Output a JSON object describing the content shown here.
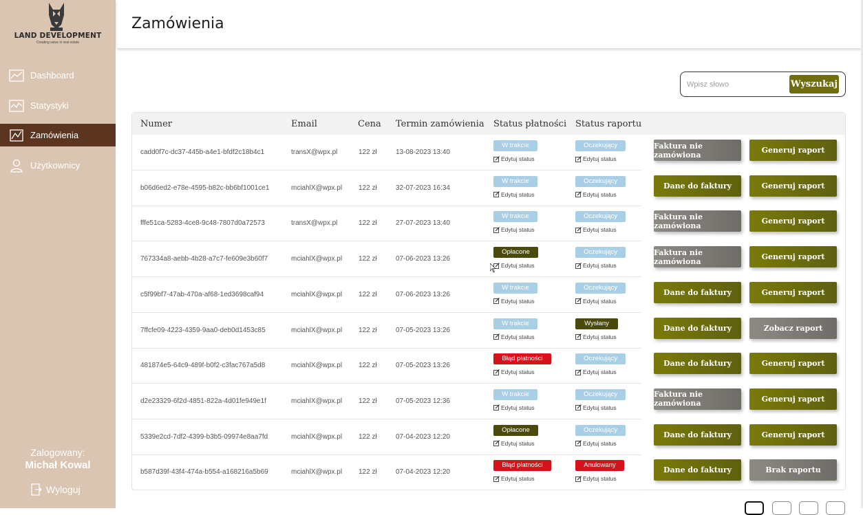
{
  "app": {
    "logo_title": "LAND DEVELOPMENT",
    "logo_subtitle": "Creating value in real estate"
  },
  "sidebar": {
    "items": [
      {
        "label": "Dashboard",
        "icon": "chart-line-icon"
      },
      {
        "label": "Statystyki",
        "icon": "trend-chart-icon"
      },
      {
        "label": "Zamówienia",
        "icon": "orders-chart-icon",
        "active": true
      },
      {
        "label": "Użytkownicy",
        "icon": "user-icon"
      }
    ],
    "logged_label": "Zalogowany:",
    "user_name": "Michał Kowal",
    "logout_label": "Wyloguj"
  },
  "header": {
    "title": "Zamówienia"
  },
  "search": {
    "placeholder": "Wpisz słowo",
    "button_label": "Wyszukaj"
  },
  "table": {
    "columns": [
      "Numer",
      "Email",
      "Cena",
      "Termin zamówienia",
      "Status płatności",
      "Status raportu"
    ],
    "edit_label": "Edytuj status",
    "rows": [
      {
        "numer": "cadd0f7c-dc37-445b-a4e1-bfdf2c18b4c1",
        "email": "transX@wpx.pl",
        "cena": "122 zł",
        "termin": "13-08-2023 13:40",
        "platnosc": "W trakcie",
        "raport": "Oczekujący",
        "btn1": "Faktura nie zamówiona",
        "btn2": "Generuj raport"
      },
      {
        "numer": "b06d6ed2-e78e-4595-b82c-bb6bf1001ce1",
        "email": "mciahlX@wpx.pl",
        "cena": "122 zł",
        "termin": "32-07-2023 16:34",
        "platnosc": "W trakcie",
        "raport": "Oczekujący",
        "btn1": "Dane do faktury",
        "btn2": "Generuj raport"
      },
      {
        "numer": "fffe51ca-5283-4ce8-9c48-7807d0a72573",
        "email": "transX@wpx.pl",
        "cena": "122 zł",
        "termin": "27-07-2023 13:40",
        "platnosc": "W trakcie",
        "raport": "Oczekujący",
        "btn1": "Faktura nie zamówiona",
        "btn2": "Generuj raport"
      },
      {
        "numer": "767334a8-aebb-4b28-a7c7-fe609e3b60f7",
        "email": "mciahlX@wpx.pl",
        "cena": "122 zł",
        "termin": "07-06-2023 13:26",
        "platnosc": "Opłacone",
        "raport": "Oczekujący",
        "btn1": "Faktura nie zamówiona",
        "btn2": "Generuj raport"
      },
      {
        "numer": "c5f99bf7-47ab-470a-af68-1ed3698caf94",
        "email": "mciahlX@wpx.pl",
        "cena": "122 zł",
        "termin": "07-06-2023 13:26",
        "platnosc": "W trakcie",
        "raport": "Oczekujący",
        "btn1": "Dane do faktury",
        "btn2": "Generuj raport"
      },
      {
        "numer": "7ffcfe09-4223-4359-9aa0-deb0d1453c85",
        "email": "mciahlX@wpx.pl",
        "cena": "122 zł",
        "termin": "07-05-2023 13:26",
        "platnosc": "W trakcie",
        "raport": "Wysłany",
        "btn1": "Dane do faktury",
        "btn2": "Zobacz raport"
      },
      {
        "numer": "481874e5-64c9-489f-b0f2-c3fac767a5d8",
        "email": "mciahlX@wpx.pl",
        "cena": "122 zł",
        "termin": "07-05-2023 13:26",
        "platnosc": "Błąd płatności",
        "raport": "Oczekujący",
        "btn1": "Dane do faktury",
        "btn2": "Generuj raport"
      },
      {
        "numer": "d2e23329-6f2d-4851-822a-4d01fe949e1f",
        "email": "mciahlX@wpx.pl",
        "cena": "122 zł",
        "termin": "07-05-2023 12:36",
        "platnosc": "W trakcie",
        "raport": "Oczekujący",
        "btn1": "Faktura nie zamówiona",
        "btn2": "Generuj raport"
      },
      {
        "numer": "5339e2cd-7df2-4399-b3b5-09974e8aa7fd",
        "email": "mciahlX@wpx.pl",
        "cena": "122 zł",
        "termin": "07-04-2023 12:20",
        "platnosc": "Opłacone",
        "raport": "Oczekujący",
        "btn1": "Dane do faktury",
        "btn2": "Generuj raport"
      },
      {
        "numer": "b587d39f-43f4-474a-b554-a168216a5b69",
        "email": "mciahlX@wpx.pl",
        "cena": "122 zł",
        "termin": "07-04-2023 12:20",
        "platnosc": "Błąd płatności",
        "raport": "Anulowany",
        "btn1": "Dane do faktury",
        "btn2": "Brak raportu"
      }
    ]
  },
  "colors": {
    "sidebar_bg": "#d9c5b2",
    "sidebar_active": "#5c3520",
    "olive": "#6f6d10",
    "status_light_blue": "#a9cfe6",
    "status_dark_olive": "#4b4a0c",
    "status_red": "#d4141c",
    "grey_button": "#7d7a76"
  }
}
